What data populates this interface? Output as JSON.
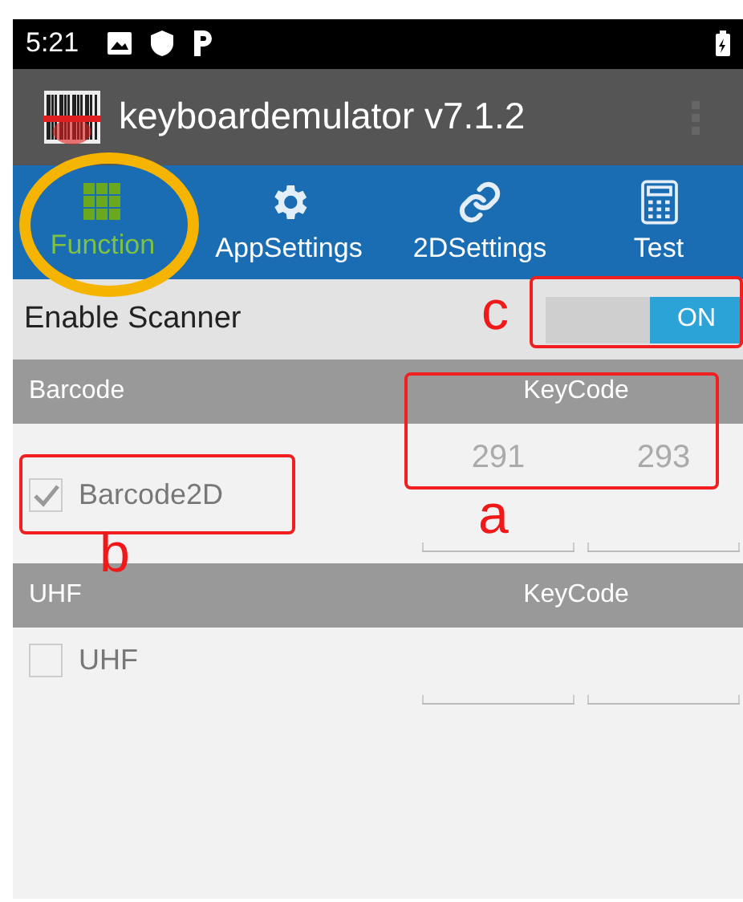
{
  "status_bar": {
    "time": "5:21"
  },
  "app_bar": {
    "title": "keyboardemulator v7.1.2"
  },
  "tabs": [
    {
      "label": "Function",
      "selected": true
    },
    {
      "label": "AppSettings",
      "selected": false
    },
    {
      "label": "2DSettings",
      "selected": false
    },
    {
      "label": "Test",
      "selected": false
    }
  ],
  "enable_scanner": {
    "label": "Enable Scanner",
    "switch_label": "ON",
    "on": true
  },
  "sections": [
    {
      "title": "Barcode",
      "keycode_header": "KeyCode",
      "item": {
        "label": "Barcode2D",
        "checked": true,
        "keycodes": [
          "291",
          "293"
        ]
      }
    },
    {
      "title": "UHF",
      "keycode_header": "KeyCode",
      "item": {
        "label": "UHF",
        "checked": false
      }
    }
  ],
  "annotations": [
    {
      "kind": "ellipse"
    },
    {
      "kind": "rect",
      "letter": "c"
    },
    {
      "kind": "rect",
      "letter": "a"
    },
    {
      "kind": "rect",
      "letter": "b"
    }
  ]
}
